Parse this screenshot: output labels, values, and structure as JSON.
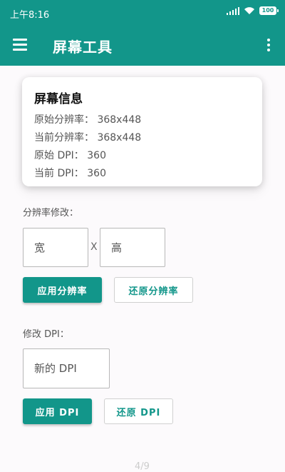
{
  "status_bar": {
    "time": "上午8:16",
    "battery": "100"
  },
  "toolbar": {
    "title": "屏幕工具"
  },
  "colors": {
    "primary": "#12968a",
    "background": "#fcfafc"
  },
  "screen_info": {
    "title": "屏幕信息",
    "lines": [
      "原始分辨率：  368x448",
      "当前分辨率：  368x448",
      "原始 DPI：  360",
      "当前 DPI：  360"
    ]
  },
  "resolution": {
    "label": "分辨率修改：",
    "width_placeholder": "宽",
    "separator": "X",
    "height_placeholder": "高",
    "apply_label": "应用分辨率",
    "restore_label": "还原分辨率"
  },
  "dpi": {
    "label": "修改 DPI：",
    "input_placeholder": "新的 DPI",
    "apply_label": "应用 DPI",
    "restore_label": "还原 DPI"
  },
  "pager": {
    "text": "4/9"
  }
}
